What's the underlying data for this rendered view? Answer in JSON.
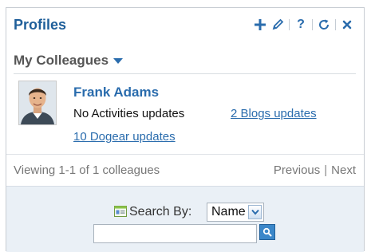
{
  "header": {
    "title": "Profiles",
    "tools": [
      {
        "icon": "plus-icon",
        "color": "#2a6cad"
      },
      {
        "icon": "pencil-icon",
        "color": "#2a6cad"
      },
      {
        "icon": "help-icon",
        "label": "?",
        "color": "#2a6cad"
      },
      {
        "icon": "refresh-icon",
        "color": "#2a6cad"
      },
      {
        "icon": "close-icon",
        "color": "#2a6cad"
      }
    ]
  },
  "section": {
    "label": "My Colleagues",
    "caret_icon": "caret-down-icon"
  },
  "colleague": {
    "name": "Frank Adams",
    "activities": "No Activities updates",
    "blogs": "2 Blogs updates",
    "dogear": "10 Dogear updates",
    "avatar_icon": "person-photo"
  },
  "pagination": {
    "viewing": "Viewing 1-1 of 1 colleagues",
    "previous": "Previous",
    "separator": "|",
    "next": "Next"
  },
  "search": {
    "label": "Search By:",
    "selected": "Name",
    "input_value": "",
    "card_icon": "business-card-icon",
    "button_icon": "search-icon"
  },
  "colors": {
    "accent": "#2a6cad",
    "panel": "#eaf0f6"
  }
}
